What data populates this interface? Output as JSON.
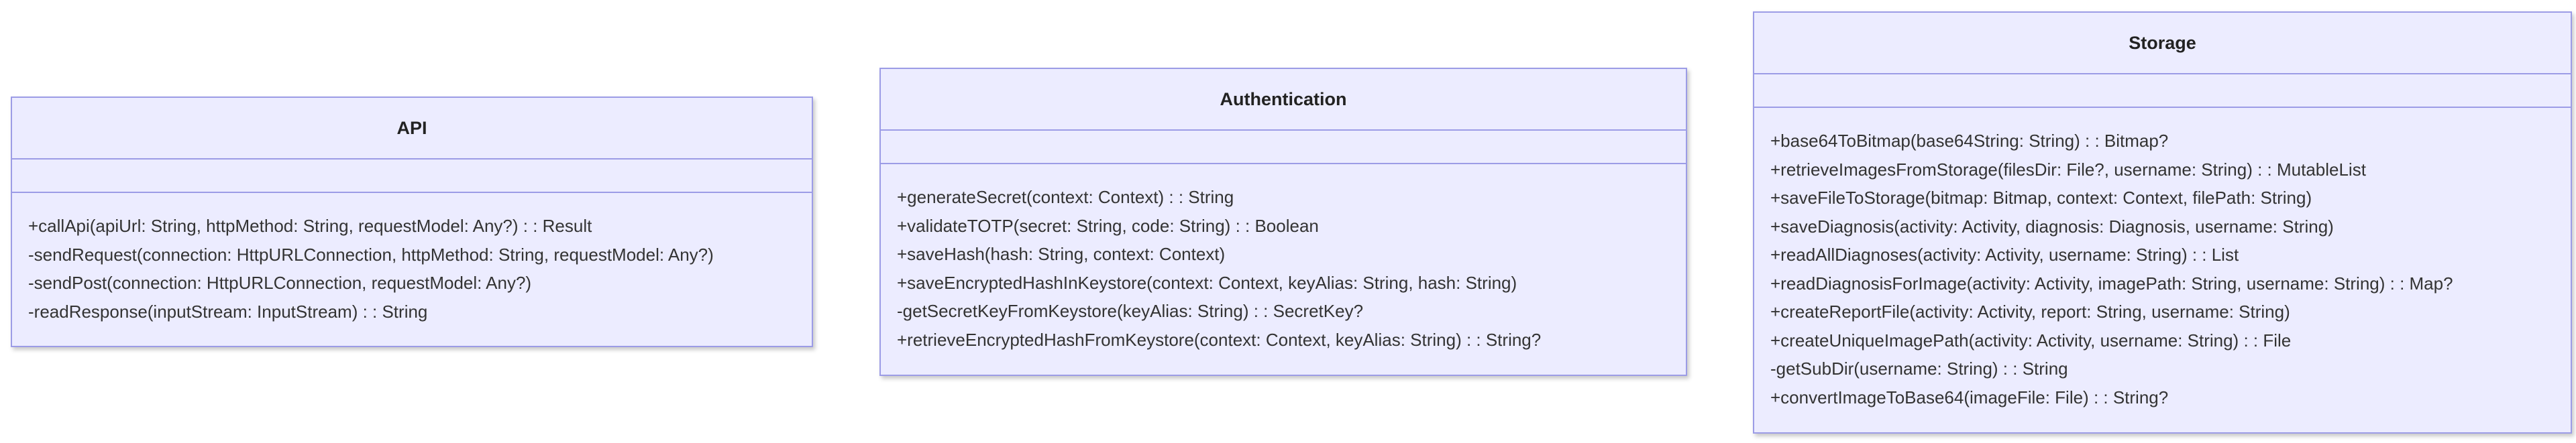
{
  "classes": [
    {
      "id": "api",
      "name": "API",
      "attributes": [],
      "methods": [
        "+callApi(apiUrl: String, httpMethod: String, requestModel: Any?) : : Result",
        "-sendRequest(connection: HttpURLConnection, httpMethod: String, requestModel: Any?)",
        "-sendPost(connection: HttpURLConnection, requestModel: Any?)",
        "-readResponse(inputStream: InputStream) : : String"
      ]
    },
    {
      "id": "authentication",
      "name": "Authentication",
      "attributes": [],
      "methods": [
        "+generateSecret(context: Context) : : String",
        "+validateTOTP(secret: String, code: String) : : Boolean",
        "+saveHash(hash: String, context: Context)",
        "+saveEncryptedHashInKeystore(context: Context, keyAlias: String, hash: String)",
        "-getSecretKeyFromKeystore(keyAlias: String) : : SecretKey?",
        "+retrieveEncryptedHashFromKeystore(context: Context, keyAlias: String) : : String?"
      ]
    },
    {
      "id": "storage",
      "name": "Storage",
      "attributes": [],
      "methods": [
        "+base64ToBitmap(base64String: String) : : Bitmap?",
        "+retrieveImagesFromStorage(filesDir: File?, username: String) : : MutableList",
        "+saveFileToStorage(bitmap: Bitmap, context: Context, filePath: String)",
        "+saveDiagnosis(activity: Activity, diagnosis: Diagnosis, username: String)",
        "+readAllDiagnoses(activity: Activity, username: String) : : List",
        "+readDiagnosisForImage(activity: Activity, imagePath: String, username: String) : : Map?",
        "+createReportFile(activity: Activity, report: String, username: String)",
        "+createUniqueImagePath(activity: Activity, username: String) : : File",
        "-getSubDir(username: String) : : String",
        "+convertImageToBase64(imageFile: File) : : String?"
      ]
    }
  ],
  "colors": {
    "box_fill": "#ececff",
    "box_border": "#9c9ce6",
    "text": "#333333"
  }
}
